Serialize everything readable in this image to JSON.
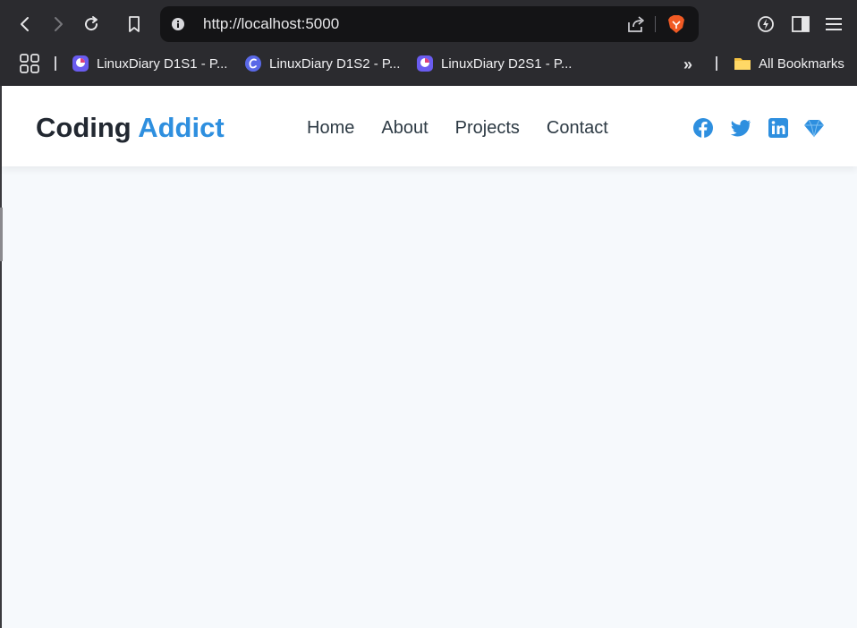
{
  "browser": {
    "url": "http://localhost:5000",
    "bookmarks": [
      {
        "label": "LinuxDiary D1S1 - P...",
        "icon": "linuxdiary-favicon"
      },
      {
        "label": "LinuxDiary D1S2 - P...",
        "icon": "canva-favicon"
      },
      {
        "label": "LinuxDiary D2S1 - P...",
        "icon": "linuxdiary-favicon"
      }
    ],
    "all_bookmarks_label": "All Bookmarks",
    "more_label": "»"
  },
  "site": {
    "logo_primary": "Coding",
    "logo_accent": "Addict",
    "nav": [
      "Home",
      "About",
      "Projects",
      "Contact"
    ],
    "social_icons": [
      "facebook-icon",
      "twitter-icon",
      "linkedin-icon",
      "diamond-icon"
    ]
  },
  "colors": {
    "accent": "#2e8fdf",
    "logo_dark": "#222831",
    "nav_text": "#2d3a44",
    "chrome_bg": "#2b2b2f",
    "omnibox_bg": "#141416",
    "page_bg": "#f6f9fc"
  }
}
